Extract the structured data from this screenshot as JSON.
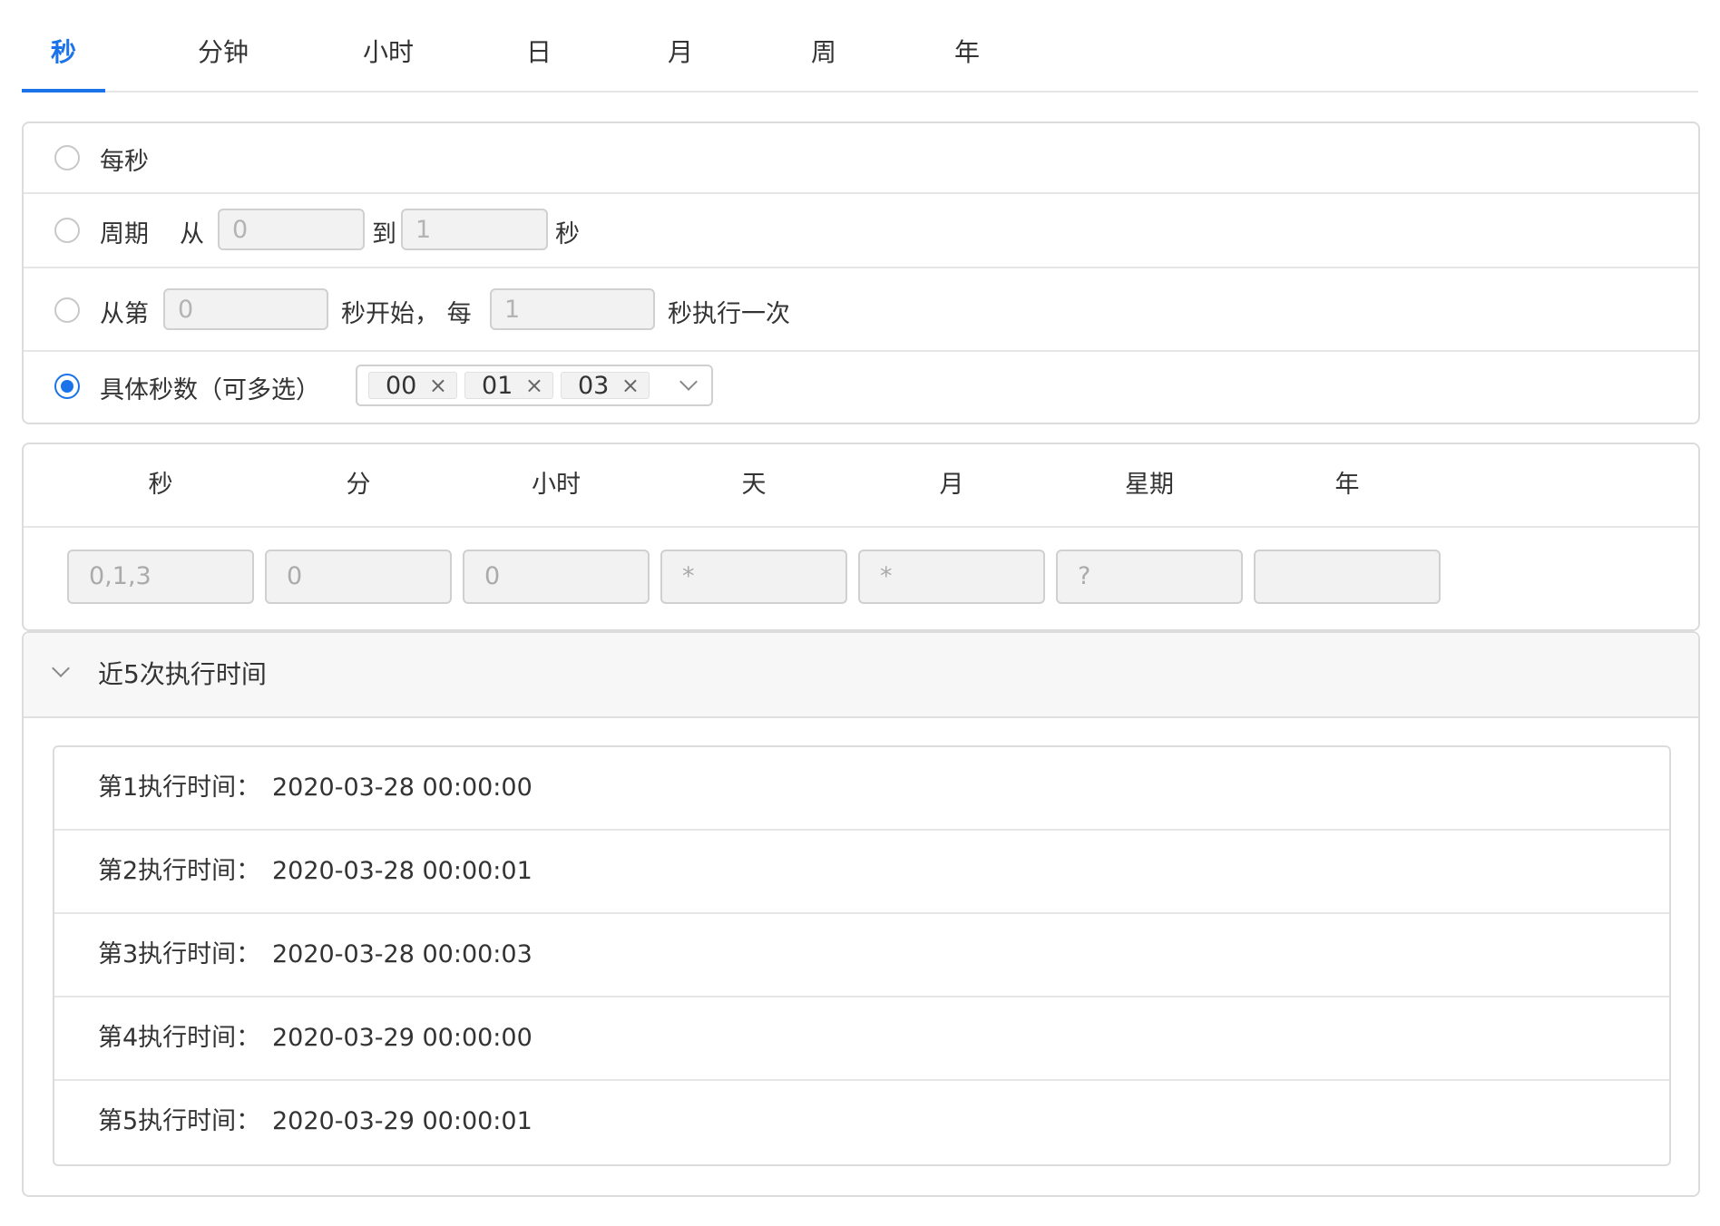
{
  "tabs": [
    "秒",
    "分钟",
    "小时",
    "日",
    "月",
    "周",
    "年"
  ],
  "options": {
    "every": {
      "label": "每秒"
    },
    "cycle": {
      "label": "周期",
      "from_label": "从",
      "from_value": "0",
      "to_label": "到",
      "to_value": "1",
      "unit": "秒"
    },
    "interval": {
      "label": "从第",
      "start_value": "0",
      "middle": "秒开始， 每",
      "step_value": "1",
      "suffix": "秒执行一次"
    },
    "specific": {
      "label": "具体秒数（可多选）",
      "selected": [
        "00",
        "01",
        "03"
      ],
      "remove_glyph": "×"
    }
  },
  "selected_option": "specific",
  "cron": {
    "headers": [
      "秒",
      "分",
      "小时",
      "天",
      "月",
      "星期",
      "年"
    ],
    "values": [
      "0,1,3",
      "0",
      "0",
      "*",
      "*",
      "?",
      ""
    ]
  },
  "runs": {
    "title": "近5次执行时间",
    "items": [
      {
        "label": "第1执行时间：",
        "time": "2020-03-28 00:00:00"
      },
      {
        "label": "第2执行时间：",
        "time": "2020-03-28 00:00:01"
      },
      {
        "label": "第3执行时间：",
        "time": "2020-03-28 00:00:03"
      },
      {
        "label": "第4执行时间：",
        "time": "2020-03-29 00:00:00"
      },
      {
        "label": "第5执行时间：",
        "time": "2020-03-29 00:00:01"
      }
    ]
  },
  "colors": {
    "accent": "#1a73e8",
    "border": "#dcdcdc",
    "input_bg": "#f2f2f2",
    "panel_header_bg": "#f7f7f7"
  }
}
